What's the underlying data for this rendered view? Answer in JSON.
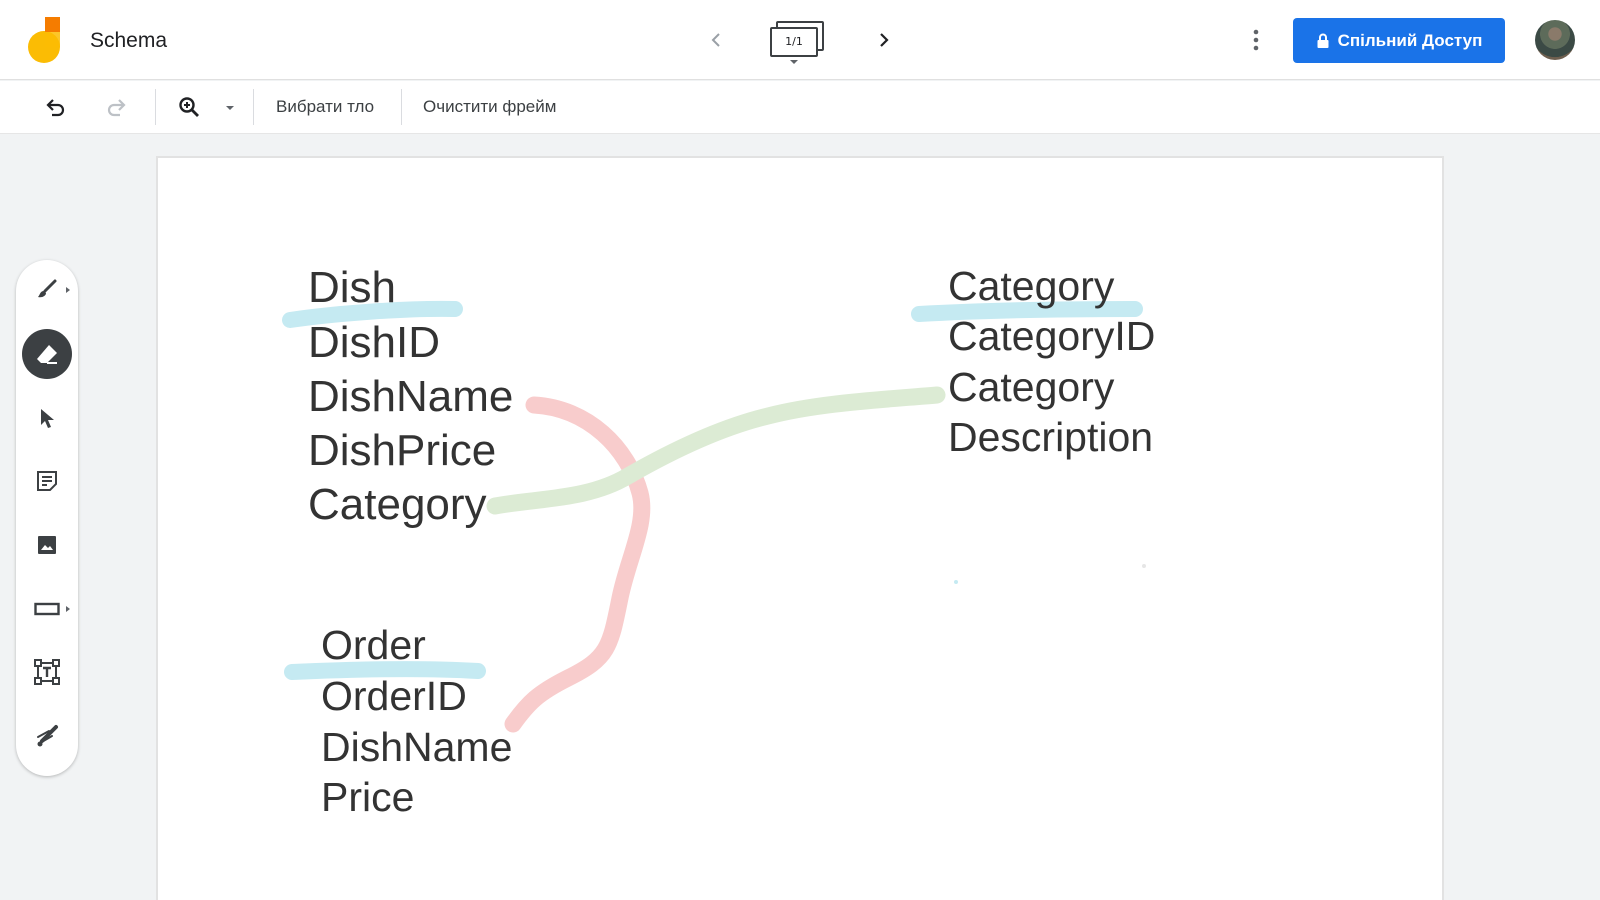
{
  "app": {
    "title": "Schema"
  },
  "header": {
    "frame_counter": "1/1",
    "share_label": "Спільний Доступ"
  },
  "toolbar": {
    "set_background": "Вибрати тло",
    "clear_frame": "Очистити фрейм"
  },
  "tools": [
    "pen",
    "eraser",
    "select",
    "sticky-note",
    "image",
    "shape",
    "text-box",
    "laser"
  ],
  "active_tool": "eraser",
  "canvas": {
    "dish_table": [
      "Dish",
      "DishID",
      "DishName",
      "DishPrice",
      "Category"
    ],
    "category_table": [
      "Category",
      "CategoryID",
      "Category",
      "Description"
    ],
    "order_table": [
      "Order",
      "OrderID",
      "DishName",
      "Price"
    ]
  },
  "colors": {
    "accent": "#1a73e8",
    "highlight_blue": "#c5eaf2",
    "link_red": "#f8cccc",
    "link_green": "#dcebd4"
  }
}
